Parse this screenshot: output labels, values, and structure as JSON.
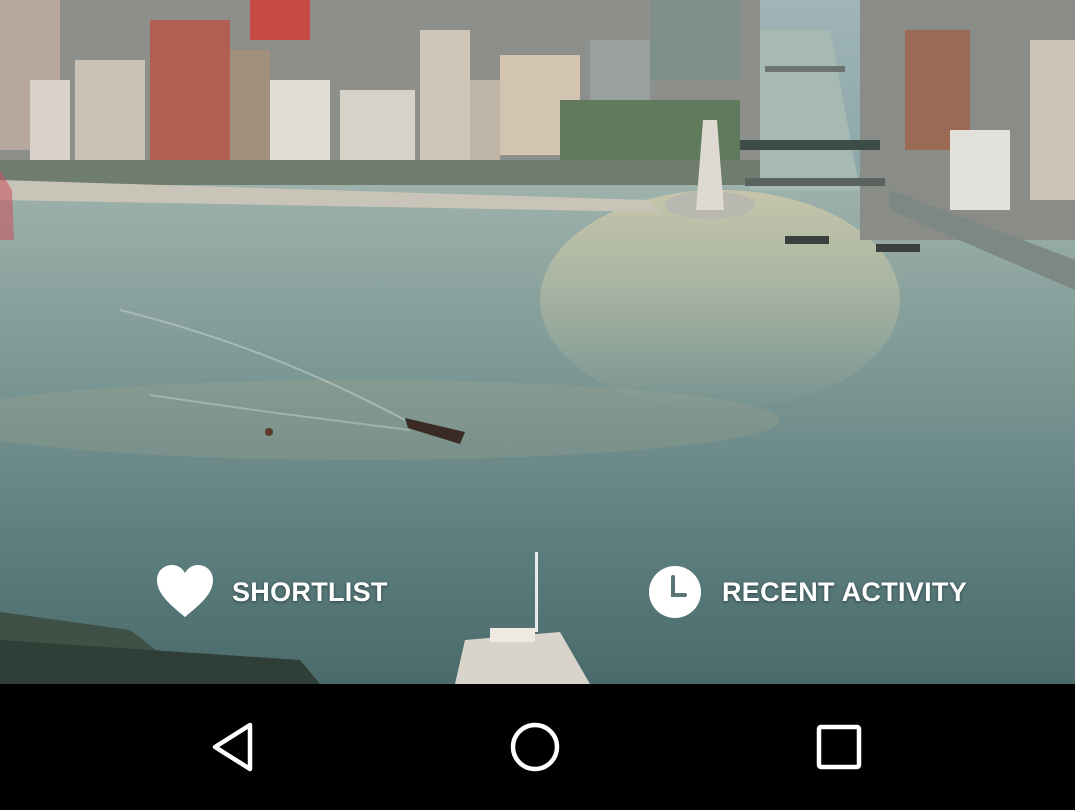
{
  "quick_links": {
    "shortlist": {
      "label": "SHORTLIST",
      "icon": "heart-icon"
    },
    "recent_activity": {
      "label": "RECENT ACTIVITY",
      "icon": "clock-icon"
    }
  },
  "navbar": {
    "back_icon": "back-triangle-icon",
    "home_icon": "home-circle-icon",
    "recents_icon": "recents-square-icon"
  },
  "colors": {
    "label_text": "#ffffff",
    "navbar_bg": "#000000"
  }
}
